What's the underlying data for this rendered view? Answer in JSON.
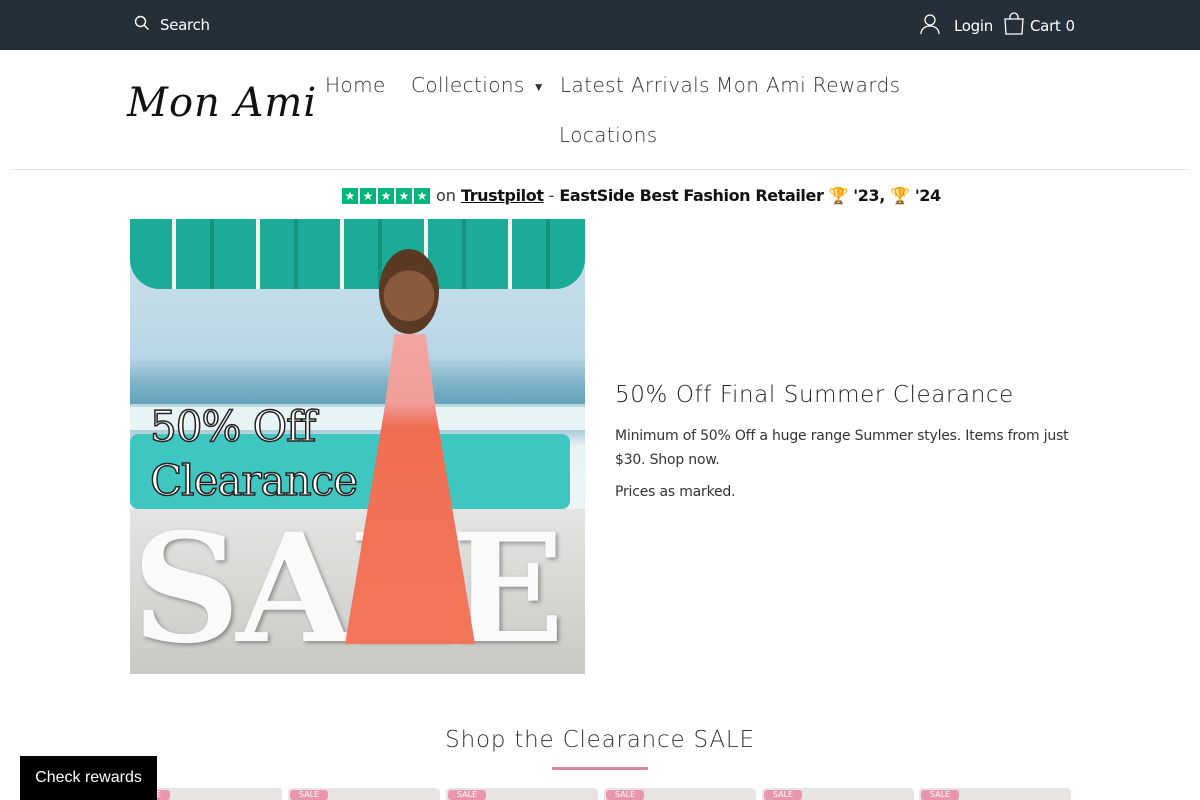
{
  "topbar": {
    "search_placeholder": "Search",
    "login_label": "Login",
    "cart_label": "Cart",
    "cart_count": "0"
  },
  "header": {
    "logo_text": "Mon Ami",
    "nav": {
      "home": "Home",
      "collections": "Collections",
      "latest": "Latest Arrivals",
      "rewards": "Mon Ami Rewards",
      "locations": "Locations"
    }
  },
  "trust": {
    "stars": [
      "★",
      "★",
      "★",
      "★",
      "★"
    ],
    "on": "on",
    "link": "Trustpilot",
    "dash": "-",
    "award": "EastSide Best Fashion Retailer 🏆 '23, 🏆 '24"
  },
  "hero": {
    "image_line1": "50% Off",
    "image_line2": "Clearance",
    "image_sale": "SALE",
    "title": "50% Off Final Summer Clearance",
    "description": "Minimum of 50% Off a huge range Summer styles. Items from just $30. Shop now.",
    "note": "Prices as marked."
  },
  "section": {
    "title": "Shop the Clearance SALE"
  },
  "products": [
    {
      "badge": "SALE"
    },
    {
      "badge": "SALE"
    },
    {
      "badge": "SALE"
    },
    {
      "badge": "SALE"
    },
    {
      "badge": "SALE"
    },
    {
      "badge": "SALE"
    }
  ],
  "rewards_button": "Check rewards",
  "colors": {
    "topbar": "#252f3a",
    "trustpilot_green": "#00b67a",
    "accent_pink": "#d8879f",
    "sale_badge": "#e995ad"
  }
}
